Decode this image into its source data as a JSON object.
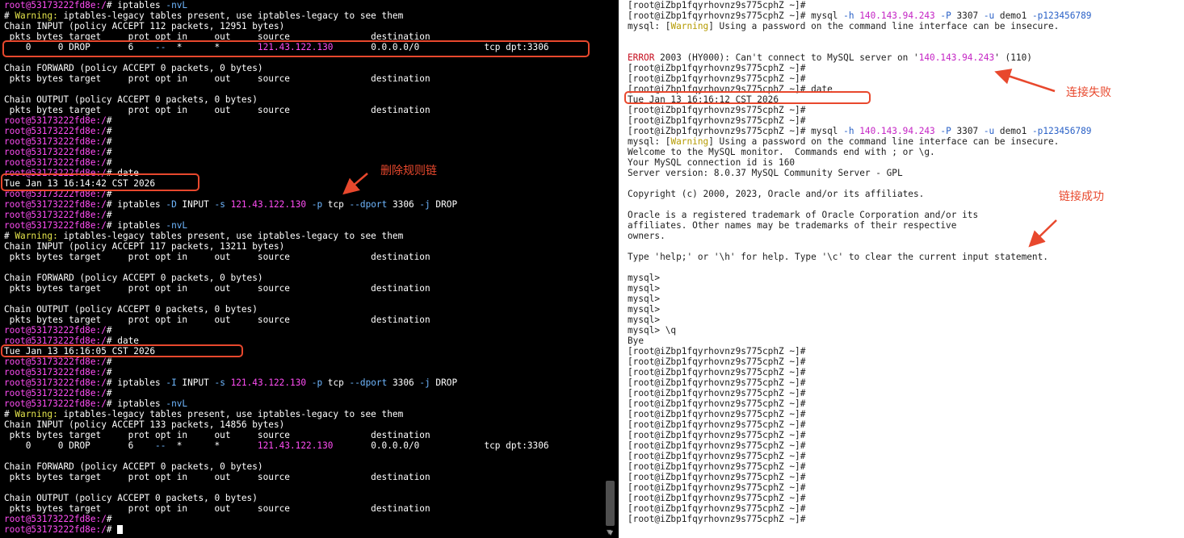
{
  "left_terminal": {
    "lines": [
      [
        {
          "t": "root@53173222fd8e:/",
          "c": "prompt"
        },
        {
          "t": "# iptables "
        },
        {
          "t": "-nvL",
          "c": "opt"
        }
      ],
      [
        {
          "t": "# "
        },
        {
          "t": "Warning:",
          "c": "warn"
        },
        {
          "t": " iptables-legacy tables present, use iptables-legacy to see them"
        }
      ],
      [
        {
          "t": "Chain INPUT (policy ACCEPT 112 packets, 12951 bytes)"
        }
      ],
      [
        {
          "t": " pkts bytes target     prot opt in     out     source               destination"
        }
      ],
      [
        {
          "t": "    0     0 DROP       6    "
        },
        {
          "t": "--",
          "c": "opt"
        },
        {
          "t": "  *      *       "
        },
        {
          "t": "121.43.122.130",
          "c": "ip"
        },
        {
          "t": "       0.0.0.0/0            tcp dpt:3306"
        }
      ],
      [],
      [
        {
          "t": "Chain FORWARD (policy ACCEPT 0 packets, 0 bytes)"
        }
      ],
      [
        {
          "t": " pkts bytes target     prot opt in     out     source               destination"
        }
      ],
      [],
      [
        {
          "t": "Chain OUTPUT (policy ACCEPT 0 packets, 0 bytes)"
        }
      ],
      [
        {
          "t": " pkts bytes target     prot opt in     out     source               destination"
        }
      ],
      [
        {
          "t": "root@53173222fd8e:/",
          "c": "prompt"
        },
        {
          "t": "#"
        }
      ],
      [
        {
          "t": "root@53173222fd8e:/",
          "c": "prompt"
        },
        {
          "t": "#"
        }
      ],
      [
        {
          "t": "root@53173222fd8e:/",
          "c": "prompt"
        },
        {
          "t": "#"
        }
      ],
      [
        {
          "t": "root@53173222fd8e:/",
          "c": "prompt"
        },
        {
          "t": "#"
        }
      ],
      [
        {
          "t": "root@53173222fd8e:/",
          "c": "prompt"
        },
        {
          "t": "#"
        }
      ],
      [
        {
          "t": "root@53173222fd8e:/",
          "c": "prompt"
        },
        {
          "t": "# date"
        }
      ],
      [
        {
          "t": "Tue Jan 13 16:14:42 CST 2026"
        }
      ],
      [
        {
          "t": "root@53173222fd8e:/",
          "c": "prompt"
        },
        {
          "t": "#"
        }
      ],
      [
        {
          "t": "root@53173222fd8e:/",
          "c": "prompt"
        },
        {
          "t": "# iptables "
        },
        {
          "t": "-D",
          "c": "opt"
        },
        {
          "t": " INPUT "
        },
        {
          "t": "-s",
          "c": "opt"
        },
        {
          "t": " "
        },
        {
          "t": "121.43.122.130",
          "c": "ip"
        },
        {
          "t": " "
        },
        {
          "t": "-p",
          "c": "opt"
        },
        {
          "t": " tcp "
        },
        {
          "t": "--dport",
          "c": "opt"
        },
        {
          "t": " 3306 "
        },
        {
          "t": "-j",
          "c": "opt"
        },
        {
          "t": " DROP"
        }
      ],
      [
        {
          "t": "root@53173222fd8e:/",
          "c": "prompt"
        },
        {
          "t": "#"
        }
      ],
      [
        {
          "t": "root@53173222fd8e:/",
          "c": "prompt"
        },
        {
          "t": "# iptables "
        },
        {
          "t": "-nvL",
          "c": "opt"
        }
      ],
      [
        {
          "t": "# "
        },
        {
          "t": "Warning:",
          "c": "warn"
        },
        {
          "t": " iptables-legacy tables present, use iptables-legacy to see them"
        }
      ],
      [
        {
          "t": "Chain INPUT (policy ACCEPT 117 packets, 13211 bytes)"
        }
      ],
      [
        {
          "t": " pkts bytes target     prot opt in     out     source               destination"
        }
      ],
      [],
      [
        {
          "t": "Chain FORWARD (policy ACCEPT 0 packets, 0 bytes)"
        }
      ],
      [
        {
          "t": " pkts bytes target     prot opt in     out     source               destination"
        }
      ],
      [],
      [
        {
          "t": "Chain OUTPUT (policy ACCEPT 0 packets, 0 bytes)"
        }
      ],
      [
        {
          "t": " pkts bytes target     prot opt in     out     source               destination"
        }
      ],
      [
        {
          "t": "root@53173222fd8e:/",
          "c": "prompt"
        },
        {
          "t": "#"
        }
      ],
      [
        {
          "t": "root@53173222fd8e:/",
          "c": "prompt"
        },
        {
          "t": "# date"
        }
      ],
      [
        {
          "t": "Tue Jan 13 16:16:05 CST 2026"
        }
      ],
      [
        {
          "t": "root@53173222fd8e:/",
          "c": "prompt"
        },
        {
          "t": "#"
        }
      ],
      [
        {
          "t": "root@53173222fd8e:/",
          "c": "prompt"
        },
        {
          "t": "#"
        }
      ],
      [
        {
          "t": "root@53173222fd8e:/",
          "c": "prompt"
        },
        {
          "t": "# iptables "
        },
        {
          "t": "-I",
          "c": "opt"
        },
        {
          "t": " INPUT "
        },
        {
          "t": "-s",
          "c": "opt"
        },
        {
          "t": " "
        },
        {
          "t": "121.43.122.130",
          "c": "ip"
        },
        {
          "t": " "
        },
        {
          "t": "-p",
          "c": "opt"
        },
        {
          "t": " tcp "
        },
        {
          "t": "--dport",
          "c": "opt"
        },
        {
          "t": " 3306 "
        },
        {
          "t": "-j",
          "c": "opt"
        },
        {
          "t": " DROP"
        }
      ],
      [
        {
          "t": "root@53173222fd8e:/",
          "c": "prompt"
        },
        {
          "t": "#"
        }
      ],
      [
        {
          "t": "root@53173222fd8e:/",
          "c": "prompt"
        },
        {
          "t": "# iptables "
        },
        {
          "t": "-nvL",
          "c": "opt"
        }
      ],
      [
        {
          "t": "# "
        },
        {
          "t": "Warning:",
          "c": "warn"
        },
        {
          "t": " iptables-legacy tables present, use iptables-legacy to see them"
        }
      ],
      [
        {
          "t": "Chain INPUT (policy ACCEPT 133 packets, 14856 bytes)"
        }
      ],
      [
        {
          "t": " pkts bytes target     prot opt in     out     source               destination"
        }
      ],
      [
        {
          "t": "    0     0 DROP       6    "
        },
        {
          "t": "--",
          "c": "opt"
        },
        {
          "t": "  *      *       "
        },
        {
          "t": "121.43.122.130",
          "c": "ip"
        },
        {
          "t": "       0.0.0.0/0            tcp dpt:3306"
        }
      ],
      [],
      [
        {
          "t": "Chain FORWARD (policy ACCEPT 0 packets, 0 bytes)"
        }
      ],
      [
        {
          "t": " pkts bytes target     prot opt in     out     source               destination"
        }
      ],
      [],
      [
        {
          "t": "Chain OUTPUT (policy ACCEPT 0 packets, 0 bytes)"
        }
      ],
      [
        {
          "t": " pkts bytes target     prot opt in     out     source               destination"
        }
      ],
      [
        {
          "t": "root@53173222fd8e:/",
          "c": "prompt"
        },
        {
          "t": "#"
        }
      ],
      [
        {
          "t": "root@53173222fd8e:/",
          "c": "prompt"
        },
        {
          "t": "# "
        },
        {
          "cursor": true
        }
      ]
    ]
  },
  "right_terminal": {
    "lines": [
      [
        {
          "t": "[root@iZbp1fqyrhovnz9s775cphZ ~]#"
        }
      ],
      [
        {
          "t": "[root@iZbp1fqyrhovnz9s775cphZ ~]# mysql "
        },
        {
          "t": "-h",
          "c": "opt"
        },
        {
          "t": " "
        },
        {
          "t": "140.143.94.243",
          "c": "ip"
        },
        {
          "t": " "
        },
        {
          "t": "-P",
          "c": "opt"
        },
        {
          "t": " 3307 "
        },
        {
          "t": "-u",
          "c": "opt"
        },
        {
          "t": " demo1 "
        },
        {
          "t": "-p123456789",
          "c": "opt"
        }
      ],
      [
        {
          "t": "mysql: ["
        },
        {
          "t": "Warning",
          "c": "warn"
        },
        {
          "t": "] Using a password on the command line interface can be insecure."
        }
      ],
      [],
      [],
      [
        {
          "t": "ERROR",
          "c": "err"
        },
        {
          "t": " 2003 (HY000): Can't connect to MySQL server on '"
        },
        {
          "t": "140.143.94.243",
          "c": "ip"
        },
        {
          "t": "' (110)"
        }
      ],
      [
        {
          "t": "[root@iZbp1fqyrhovnz9s775cphZ ~]#"
        }
      ],
      [
        {
          "t": "[root@iZbp1fqyrhovnz9s775cphZ ~]#"
        }
      ],
      [
        {
          "t": "[root@iZbp1fqyrhovnz9s775cphZ ~]# date"
        }
      ],
      [
        {
          "t": "Tue Jan 13 16:16:12 CST 2026"
        }
      ],
      [
        {
          "t": "[root@iZbp1fqyrhovnz9s775cphZ ~]#"
        }
      ],
      [
        {
          "t": "[root@iZbp1fqyrhovnz9s775cphZ ~]#"
        }
      ],
      [
        {
          "t": "[root@iZbp1fqyrhovnz9s775cphZ ~]# mysql "
        },
        {
          "t": "-h",
          "c": "opt"
        },
        {
          "t": " "
        },
        {
          "t": "140.143.94.243",
          "c": "ip"
        },
        {
          "t": " "
        },
        {
          "t": "-P",
          "c": "opt"
        },
        {
          "t": " 3307 "
        },
        {
          "t": "-u",
          "c": "opt"
        },
        {
          "t": " demo1 "
        },
        {
          "t": "-p123456789",
          "c": "opt"
        }
      ],
      [
        {
          "t": "mysql: ["
        },
        {
          "t": "Warning",
          "c": "warn"
        },
        {
          "t": "] Using a password on the command line interface can be insecure."
        }
      ],
      [
        {
          "t": "Welcome to the MySQL monitor.  Commands end with ; or \\g."
        }
      ],
      [
        {
          "t": "Your MySQL connection id is 160"
        }
      ],
      [
        {
          "t": "Server version: 8.0.37 MySQL Community Server - GPL"
        }
      ],
      [],
      [
        {
          "t": "Copyright (c) 2000, 2023, Oracle and/or its affiliates."
        }
      ],
      [],
      [
        {
          "t": "Oracle is a registered trademark of Oracle Corporation and/or its"
        }
      ],
      [
        {
          "t": "affiliates. Other names may be trademarks of their respective"
        }
      ],
      [
        {
          "t": "owners."
        }
      ],
      [],
      [
        {
          "t": "Type 'help;' or '\\h' for help. Type '\\c' to clear the current input statement."
        }
      ],
      [],
      [
        {
          "t": "mysql>"
        }
      ],
      [
        {
          "t": "mysql>"
        }
      ],
      [
        {
          "t": "mysql>"
        }
      ],
      [
        {
          "t": "mysql>"
        }
      ],
      [
        {
          "t": "mysql>"
        }
      ],
      [
        {
          "t": "mysql> \\q"
        }
      ],
      [
        {
          "t": "Bye"
        }
      ],
      [
        {
          "t": "[root@iZbp1fqyrhovnz9s775cphZ ~]#"
        }
      ],
      [
        {
          "t": "[root@iZbp1fqyrhovnz9s775cphZ ~]#"
        }
      ],
      [
        {
          "t": "[root@iZbp1fqyrhovnz9s775cphZ ~]#"
        }
      ],
      [
        {
          "t": "[root@iZbp1fqyrhovnz9s775cphZ ~]#"
        }
      ],
      [
        {
          "t": "[root@iZbp1fqyrhovnz9s775cphZ ~]#"
        }
      ],
      [
        {
          "t": "[root@iZbp1fqyrhovnz9s775cphZ ~]#"
        }
      ],
      [
        {
          "t": "[root@iZbp1fqyrhovnz9s775cphZ ~]#"
        }
      ],
      [
        {
          "t": "[root@iZbp1fqyrhovnz9s775cphZ ~]#"
        }
      ],
      [
        {
          "t": "[root@iZbp1fqyrhovnz9s775cphZ ~]#"
        }
      ],
      [
        {
          "t": "[root@iZbp1fqyrhovnz9s775cphZ ~]#"
        }
      ],
      [
        {
          "t": "[root@iZbp1fqyrhovnz9s775cphZ ~]#"
        }
      ],
      [
        {
          "t": "[root@iZbp1fqyrhovnz9s775cphZ ~]#"
        }
      ],
      [
        {
          "t": "[root@iZbp1fqyrhovnz9s775cphZ ~]#"
        }
      ],
      [
        {
          "t": "[root@iZbp1fqyrhovnz9s775cphZ ~]#"
        }
      ],
      [
        {
          "t": "[root@iZbp1fqyrhovnz9s775cphZ ~]#"
        }
      ],
      [
        {
          "t": "[root@iZbp1fqyrhovnz9s775cphZ ~]#"
        }
      ],
      [
        {
          "t": "[root@iZbp1fqyrhovnz9s775cphZ ~]#"
        }
      ]
    ]
  },
  "annotations": {
    "delete_rule": "删除规则链",
    "connect_failed": "连接失败",
    "connect_success": "链接成功"
  },
  "scroll_icons": {
    "down": "▼"
  },
  "colors": {
    "annotation": "#e8482d",
    "left_background": "#000000",
    "prompt": "#ff4df4",
    "option": "#6fb7ff",
    "warning": "#e5e54c"
  }
}
